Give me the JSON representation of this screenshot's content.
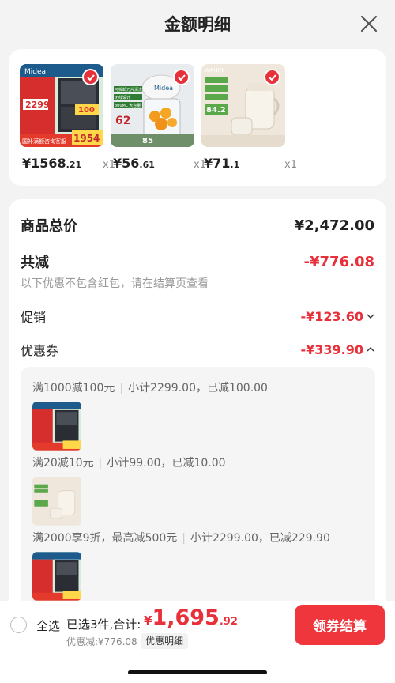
{
  "header": {
    "title": "金额明细",
    "close_icon": "close-icon"
  },
  "products": [
    {
      "price_int": "¥1568",
      "price_dec": ".21",
      "qty": "x1",
      "image": "kitchen-appliance-image",
      "img_texts": {
        "brand": "Midea",
        "price": "2299",
        "promo": "国补满额咨询客服",
        "deal": "1954",
        "badge": "100"
      }
    },
    {
      "price_int": "¥56",
      "price_dec": ".61",
      "qty": "x1",
      "image": "food-chopper-image",
      "img_texts": {
        "brand": "Midea",
        "tag1": "可拆卸刀片清洗",
        "tag2": "无线设计",
        "tag3": "300ML 大容量",
        "num": "62",
        "num2": "85"
      }
    },
    {
      "price_int": "¥71",
      "price_dec": ".1",
      "qty": "x1",
      "image": "electric-kettle-image",
      "img_texts": {
        "brand": "WAHIN",
        "num": "84.2"
      }
    }
  ],
  "summary": {
    "total_label": "商品总价",
    "total_value": "¥2,472.00",
    "reduce_label": "共减",
    "reduce_value": "-¥776.08",
    "reduce_note": "以下优惠不包含红包，请在结算页查看",
    "promo_label": "促销",
    "promo_value": "-¥123.60",
    "coupon_label": "优惠券",
    "coupon_value": "-¥339.90"
  },
  "coupons": [
    {
      "rule": "满1000减100元",
      "detail": "小计2299.00，已减100.00",
      "image": "kitchen-appliance-image"
    },
    {
      "rule": "满20减10元",
      "detail": "小计99.00，已减10.00",
      "image": "electric-kettle-image"
    },
    {
      "rule": "满2000享9折，最高减500元",
      "detail": "小计2299.00，已减229.90",
      "image": "kitchen-appliance-image"
    }
  ],
  "bottom": {
    "select_all": "全选",
    "selected": "已选3件,合计:",
    "total_yen": "¥",
    "total_int": "1,695",
    "total_dec": ".92",
    "discount": "优惠减:¥776.08",
    "detail_button": "优惠明细",
    "checkout_button": "领券结算"
  },
  "colors": {
    "accent": "#e8303a",
    "checkout": "#f0363d"
  }
}
